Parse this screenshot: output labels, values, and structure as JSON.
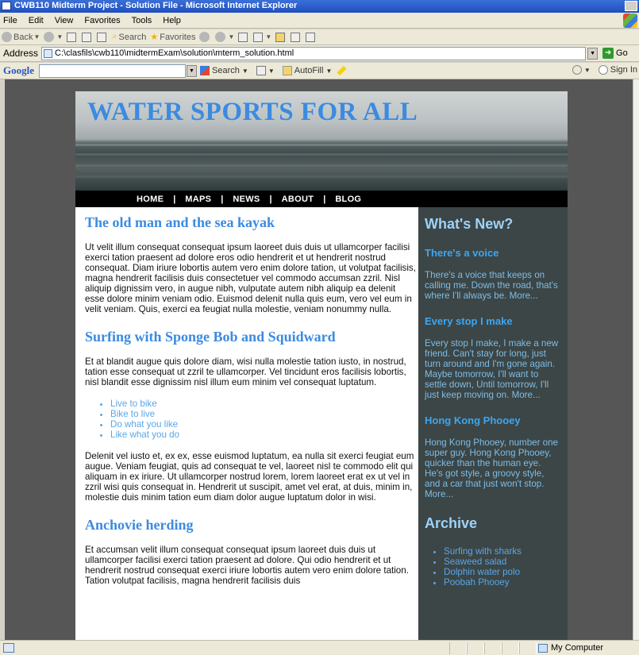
{
  "window": {
    "title": "CWB110 Midterm Project - Solution File - Microsoft Internet Explorer"
  },
  "menu": [
    "File",
    "Edit",
    "View",
    "Favorites",
    "Tools",
    "Help"
  ],
  "toolbar": {
    "back": "Back",
    "search": "Search",
    "favorites": "Favorites"
  },
  "address": {
    "label": "Address",
    "url": "C:\\clasfils\\cwb110\\midtermExam\\solution\\mterm_solution.html",
    "go": "Go"
  },
  "google": {
    "logo": "Google",
    "search": "Search",
    "autofill": "AutoFill",
    "signin": "Sign In"
  },
  "site": {
    "banner_title": "WATER SPORTS FOR ALL",
    "nav": [
      "HOME",
      "MAPS",
      "NEWS",
      "ABOUT",
      "BLOG"
    ],
    "nav_sep": "|"
  },
  "main": {
    "sections": [
      {
        "heading": "The old man and the sea kayak",
        "paragraph": "Ut velit illum consequat consequat ipsum laoreet duis duis ut ullamcorper facilisi exerci tation praesent ad dolore eros odio hendrerit et ut hendrerit nostrud consequat. Diam iriure lobortis autem vero enim dolore tation, ut volutpat facilisis, magna hendrerit facilisis duis consectetuer vel commodo accumsan zzril. Nisl aliquip dignissim vero, in augue nibh, vulputate autem nibh aliquip ea delenit esse dolore minim veniam odio. Euismod delenit nulla quis eum, vero vel eum in velit veniam. Quis, exerci ea feugiat nulla molestie, veniam nonummy nulla."
      },
      {
        "heading": "Surfing with Sponge Bob and Squidward",
        "paragraph": "Et at blandit augue quis dolore diam, wisi nulla molestie tation iusto, in nostrud, tation esse consequat ut zzril te ullamcorper. Vel tincidunt eros facilisis lobortis, nisl blandit esse dignissim nisl illum eum minim vel consequat luptatum.",
        "list": [
          "Live to bike",
          "Bike to live",
          "Do what you like",
          "Like what you do"
        ],
        "paragraph2": "Delenit vel iusto et, ex ex, esse euismod luptatum, ea nulla sit exerci feugiat eum augue. Veniam feugiat, quis ad consequat te vel, laoreet nisl te commodo elit qui aliquam in ex iriure. Ut ullamcorper nostrud lorem, lorem laoreet erat ex ut vel in zzril wisi quis consequat in. Hendrerit ut suscipit, amet vel erat, at duis, minim in, molestie duis minim tation eum diam dolor augue luptatum dolor in wisi."
      },
      {
        "heading": "Anchovie herding",
        "paragraph": "Et accumsan velit illum consequat consequat ipsum laoreet duis duis ut ullamcorper facilisi exerci tation praesent ad dolore. Qui odio hendrerit et ut hendrerit nostrud consequat exerci iriure lobortis autem vero enim dolore tation. Tation volutpat facilisis, magna hendrerit facilisis duis"
      }
    ]
  },
  "sidebar": {
    "whats_new": "What's New?",
    "items": [
      {
        "title": "There's a voice",
        "text": "There's a voice that keeps on calling me. Down the road, that's where I'll always be.",
        "more": "More..."
      },
      {
        "title": "Every stop I make",
        "text": "Every stop I make, I make a new friend. Can't stay for long, just turn around and I'm gone again. Maybe tomorrow, I'll want to settle down, Until tomorrow, I'll just keep moving on.",
        "more": "More..."
      },
      {
        "title": "Hong Kong Phooey",
        "text": "Hong Kong Phooey, number one super guy. Hong Kong Phooey, quicker than the human eye. He's got style, a groovy style, and a car that just won't stop.",
        "more": "More..."
      }
    ],
    "archive_title": "Archive",
    "archive": [
      "Surfing with sharks",
      "Seaweed salad",
      "Dolphin water polo",
      "Poobah Phooey"
    ]
  },
  "status": {
    "zone": "My Computer"
  }
}
